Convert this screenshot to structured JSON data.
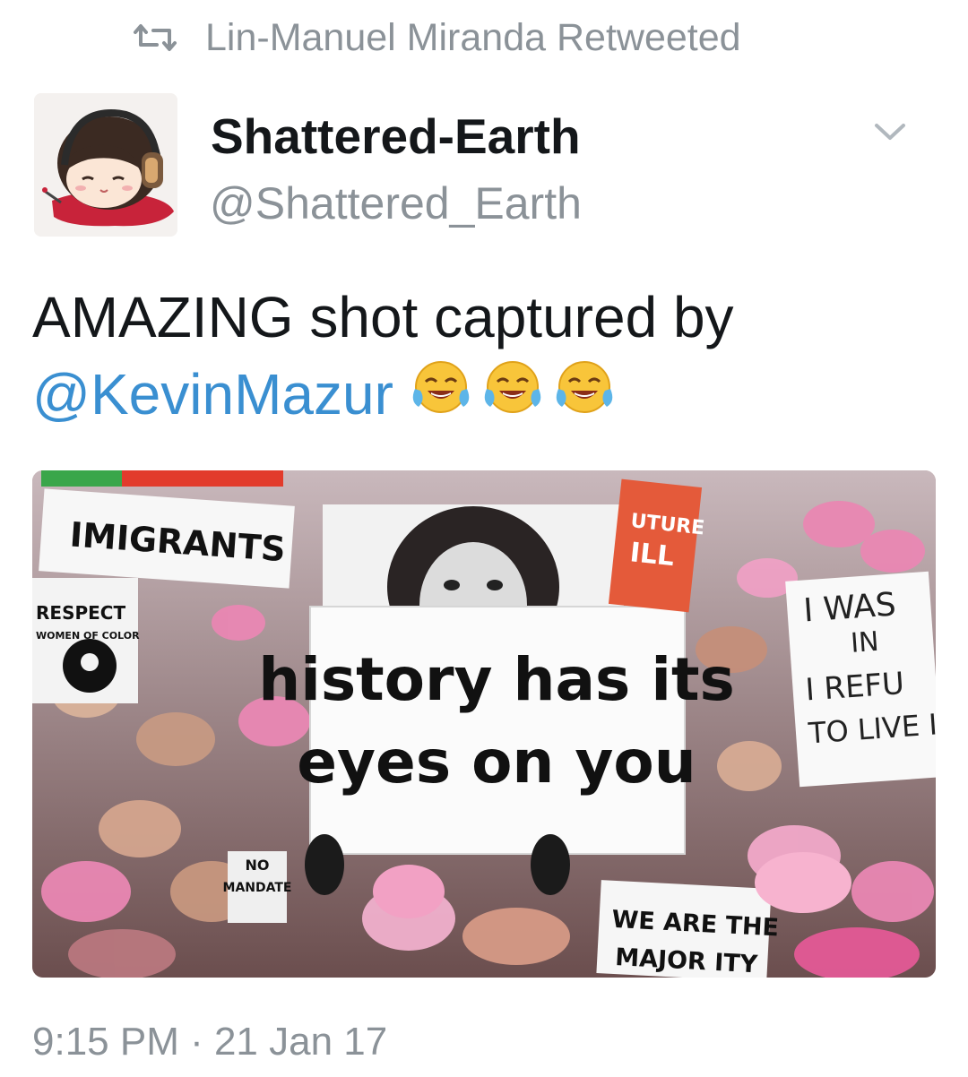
{
  "retweet_header": {
    "icon": "retweet-icon",
    "text": "Lin-Manuel Miranda Retweeted"
  },
  "author": {
    "display_name": "Shattered-Earth",
    "handle": "@Shattered_Earth",
    "avatar_icon": "cartoon-girl-headphones-avatar"
  },
  "menu": {
    "icon": "chevron-down-icon"
  },
  "tweet": {
    "text_prefix": "AMAZING shot captured by",
    "mention": "@KevinMazur",
    "emoji": [
      "face-with-tears-of-joy",
      "face-with-tears-of-joy",
      "face-with-tears-of-joy"
    ]
  },
  "photo": {
    "signs": {
      "main_line1": "history has its",
      "main_line2": "eyes on you",
      "immigrants": "IMIGRANTS",
      "respect_line1": "RESPECT",
      "respect_line2": "WOMEN OF COLOR",
      "right_line1": "I WAS",
      "right_line2": "IN",
      "right_line3": "I REFU",
      "right_line4": "TO LIVE I",
      "no_mandate_line1": "NO",
      "no_mandate_line2": "MANDATE",
      "majority_line1": "WE ARE THE",
      "majority_line2": "MAJOR ITY",
      "future_line1": "UTURE",
      "future_line2": "ILL"
    }
  },
  "timestamp": "9:15 PM · 21 Jan 17",
  "colors": {
    "mention_blue": "#3a8fd1",
    "secondary_gray": "#8b9298",
    "pussyhat_pink": "#e987b3"
  }
}
